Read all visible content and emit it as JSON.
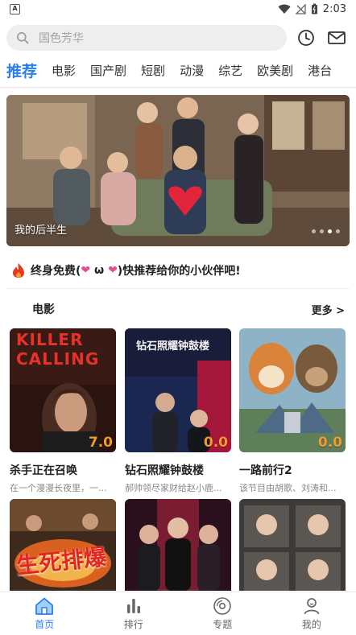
{
  "status": {
    "time": "2:03"
  },
  "search": {
    "placeholder": "国色芳华"
  },
  "tabs": [
    "推荐",
    "电影",
    "国产剧",
    "短剧",
    "动漫",
    "综艺",
    "欧美剧",
    "港台"
  ],
  "banner": {
    "title": "我的后半生",
    "total_slides": 4,
    "active_slide": 3
  },
  "promo": {
    "text_before": "终身免费(",
    "text_mid": " ω ",
    "text_after": ")快推荐给你的小伙伴吧!"
  },
  "section": {
    "title": "电影",
    "more": "更多 >"
  },
  "cards": [
    {
      "title": "杀手正在召唤",
      "desc": "在一个漫漫长夜里，一...",
      "score": "7.0",
      "poster_text": "KILLER CALLING"
    },
    {
      "title": "钻石照耀钟鼓楼",
      "desc": "郝帅领尽家财给赵小鹿...",
      "score": "0.0",
      "poster_text": "钻石照耀钟鼓楼"
    },
    {
      "title": "一路前行2",
      "desc": "该节目由胡歌、刘涛和...",
      "score": "0.0",
      "poster_text": ""
    }
  ],
  "cards_row2": [
    {
      "poster_text": "生死排爆"
    },
    {
      "poster_text": ""
    },
    {
      "poster_text": ""
    }
  ],
  "nav": [
    {
      "label": "首页",
      "icon": "home-icon",
      "active": true
    },
    {
      "label": "排行",
      "icon": "ranking-icon",
      "active": false
    },
    {
      "label": "专题",
      "icon": "topic-icon",
      "active": false
    },
    {
      "label": "我的",
      "icon": "profile-icon",
      "active": false
    }
  ],
  "colors": {
    "accent": "#2b7fe8",
    "score": "#f39a2c",
    "heart": "#e0508c",
    "fire": "#e5391d"
  }
}
